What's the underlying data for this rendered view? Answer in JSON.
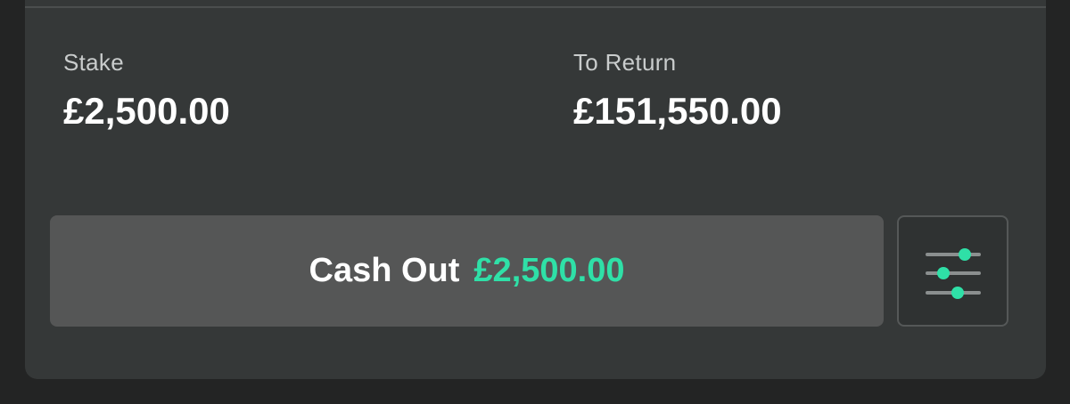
{
  "stake": {
    "label": "Stake",
    "value": "£2,500.00"
  },
  "to_return": {
    "label": "To Return",
    "value": "£151,550.00"
  },
  "cash_out": {
    "label": "Cash Out",
    "amount": "£2,500.00"
  },
  "settings": {
    "icon": "sliders-icon"
  },
  "colors": {
    "accent": "#2fe0a7",
    "card_background": "#353838",
    "button_background": "#555656",
    "page_background": "#232424"
  }
}
